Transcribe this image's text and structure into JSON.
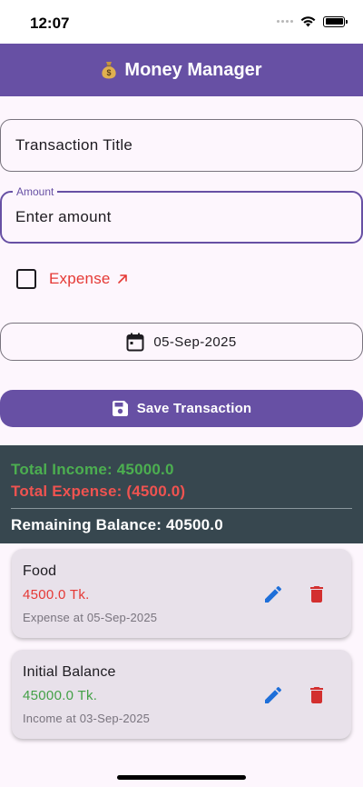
{
  "status_bar": {
    "time": "12:07"
  },
  "app_bar": {
    "title": "Money Manager",
    "icon": "money-bag-icon",
    "color": "#6750a4"
  },
  "form": {
    "title_field": {
      "placeholder": "Transaction Title",
      "value": ""
    },
    "amount_field": {
      "label": "Amount",
      "placeholder": "Enter amount",
      "value": ""
    },
    "expense_checkbox": {
      "label": "Expense",
      "checked": false,
      "icon": "arrow-up-right-icon",
      "color": "#e53935"
    },
    "date_button": {
      "label": "05-Sep-2025",
      "icon": "calendar-icon"
    },
    "save_button": {
      "label": "Save Transaction",
      "icon": "save-icon"
    }
  },
  "summary": {
    "total_income": "Total Income: 45000.0",
    "total_expense": "Total Expense: (4500.0)",
    "remaining_balance": "Remaining Balance: 40500.0",
    "background": "#37474f"
  },
  "transactions": [
    {
      "title": "Food",
      "amount": "4500.0 Tk.",
      "subtitle": "Expense at 05-Sep-2025",
      "type": "expense",
      "edit_icon": "pencil-icon",
      "delete_icon": "trash-icon"
    },
    {
      "title": "Initial Balance",
      "amount": "45000.0 Tk.",
      "subtitle": "Income at 03-Sep-2025",
      "type": "income",
      "edit_icon": "pencil-icon",
      "delete_icon": "trash-icon"
    }
  ]
}
